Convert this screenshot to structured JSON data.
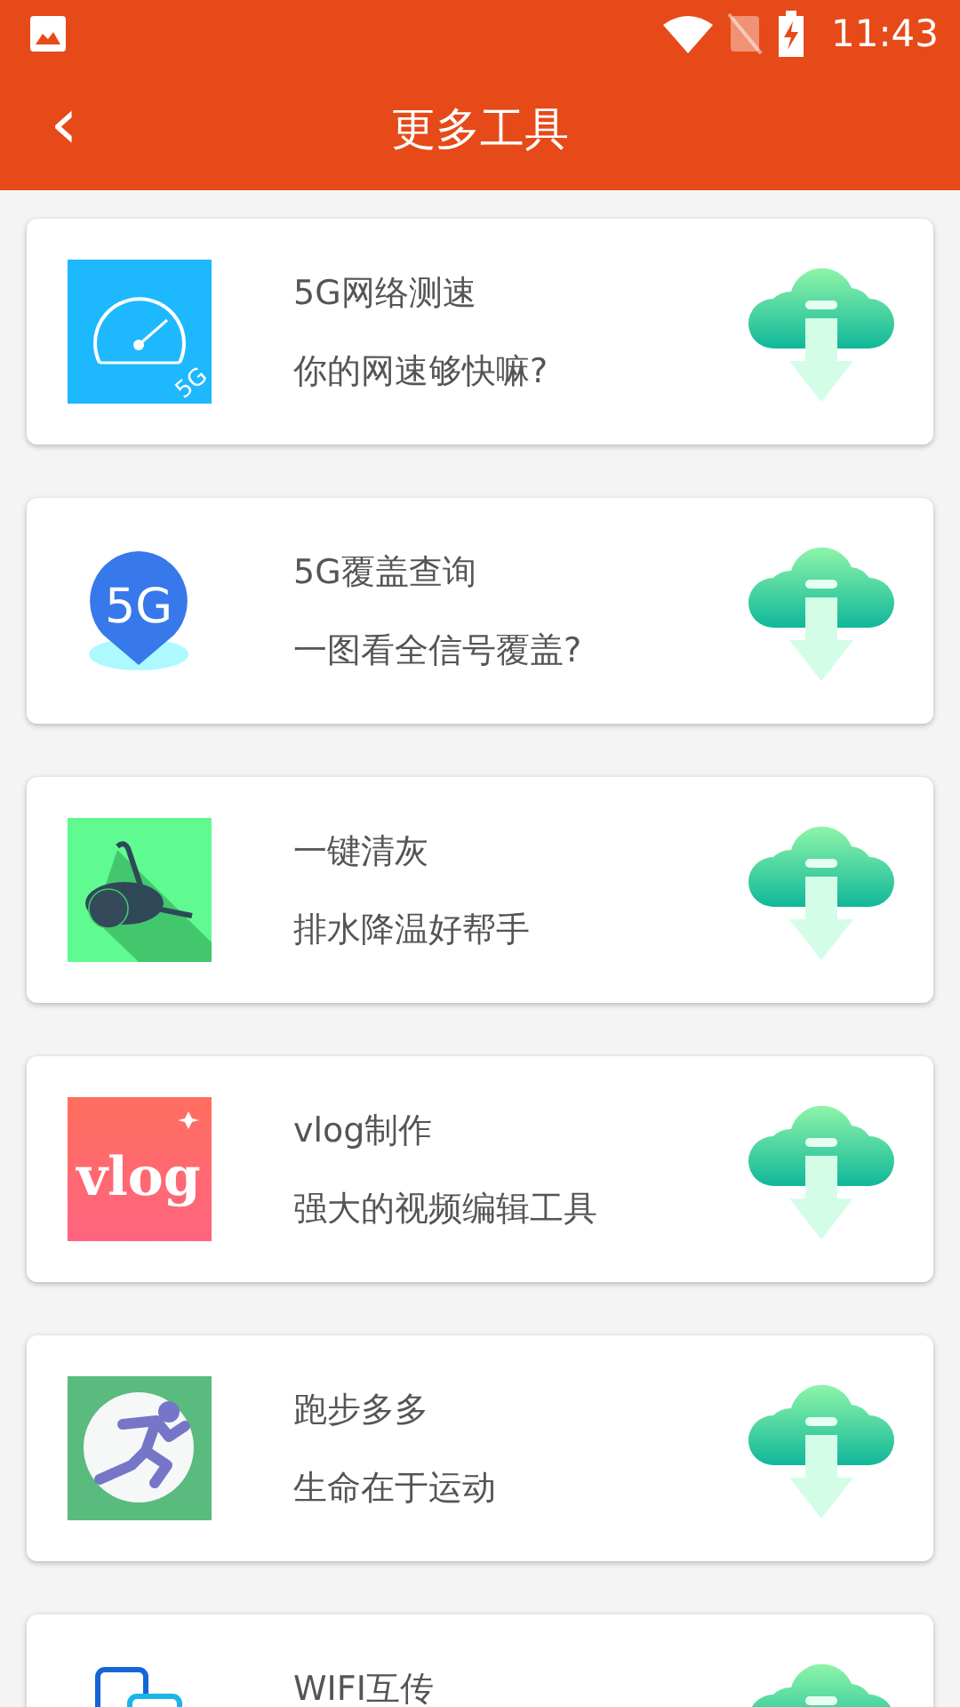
{
  "status_bar": {
    "time": "11:43"
  },
  "header": {
    "back": "‹",
    "title": "更多工具"
  },
  "tools": [
    {
      "kind": "speedometer",
      "icon_label": "5G",
      "title": "5G网络测速",
      "subtitle": "你的网速够快嘛?"
    },
    {
      "kind": "pin",
      "icon_label": "5G",
      "title": "5G覆盖查询",
      "subtitle": "一图看全信号覆盖?"
    },
    {
      "kind": "vacuum",
      "title": "一键清灰",
      "subtitle": "排水降温好帮手"
    },
    {
      "kind": "vlog",
      "icon_label": "vlog",
      "title": "vlog制作",
      "subtitle": "强大的视频编辑工具"
    },
    {
      "kind": "runner",
      "title": "跑步多多",
      "subtitle": "生命在于运动"
    },
    {
      "kind": "phones",
      "title": "WIFI互传"
    }
  ]
}
